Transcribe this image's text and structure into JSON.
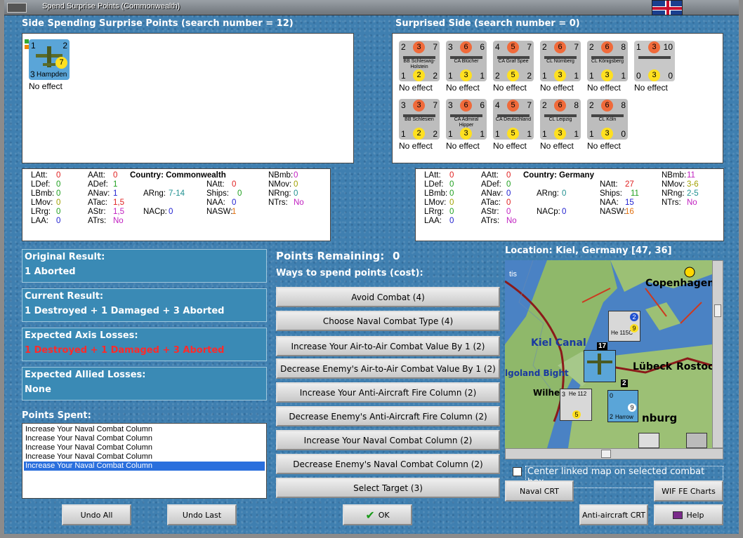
{
  "window": {
    "title": "Spend Surprise Points (Commonwealth)"
  },
  "left": {
    "header": "Side Spending Surprise Points (search number = 12)",
    "units": [
      {
        "type": "plane",
        "name": "Hampden",
        "tl": "1",
        "tr": "2",
        "bl": "3",
        "factor": "7",
        "effect": "No effect"
      }
    ]
  },
  "right": {
    "header": "Surprised Side (search number = 0)",
    "units": [
      {
        "name": "BB Schleswig-Holstein",
        "tl": "2",
        "tm": "3",
        "tr": "7",
        "bl": "1",
        "bm": "2",
        "br": "2",
        "effect": "No effect"
      },
      {
        "name": "CA Blücher",
        "tl": "3",
        "tm": "6",
        "tr": "6",
        "bl": "1",
        "bm": "3",
        "br": "1",
        "effect": "No effect"
      },
      {
        "name": "CA Graf Spee",
        "tl": "4",
        "tm": "5",
        "tr": "7",
        "bl": "2",
        "bm": "5",
        "br": "2",
        "effect": "No effect"
      },
      {
        "name": "CL Nürnberg",
        "tl": "2",
        "tm": "6",
        "tr": "7",
        "bl": "1",
        "bm": "3",
        "br": "1",
        "effect": "No effect"
      },
      {
        "name": "CL Königsberg",
        "tl": "2",
        "tm": "6",
        "tr": "8",
        "bl": "1",
        "bm": "3",
        "br": "1",
        "effect": "No effect"
      },
      {
        "name": "",
        "tl": "1",
        "tm": "3",
        "tr": "10",
        "bl": "0",
        "bm": "3",
        "br": "0",
        "effect": "No effect",
        "white": true
      },
      {
        "name": "BB Schlesien",
        "tl": "3",
        "tm": "3",
        "tr": "7",
        "bl": "1",
        "bm": "2",
        "br": "2",
        "effect": "No effect"
      },
      {
        "name": "CA Admiral Hipper",
        "tl": "3",
        "tm": "6",
        "tr": "6",
        "bl": "1",
        "bm": "3",
        "br": "1",
        "effect": "No effect"
      },
      {
        "name": "CA Deutschland",
        "tl": "4",
        "tm": "5",
        "tr": "7",
        "bl": "1",
        "bm": "5",
        "br": "1",
        "effect": "No effect"
      },
      {
        "name": "CL Leipzig",
        "tl": "2",
        "tm": "6",
        "tr": "8",
        "bl": "1",
        "bm": "3",
        "br": "1",
        "effect": "No effect"
      },
      {
        "name": "CL Köln",
        "tl": "2",
        "tm": "6",
        "tr": "8",
        "bl": "1",
        "bm": "3",
        "br": "0",
        "effect": "No effect"
      }
    ]
  },
  "stats_left": {
    "country": "Country: Commonwealth",
    "latt": "0",
    "ldef": "0",
    "lbmb": "0",
    "lmov": "0",
    "lrrg": "0",
    "laa": "0",
    "aatt": "0",
    "adef": "1",
    "anav": "1",
    "atac": "1,5",
    "astr": "1,5",
    "atrs": "No",
    "arng": "7-14",
    "nacp": "0",
    "natt": "0",
    "ships": "0",
    "naa": "0",
    "nasw": "1",
    "nbmb": "0",
    "nmov": "0",
    "nrng": "0",
    "ntrs": "No"
  },
  "stats_right": {
    "country": "Country: Germany",
    "latt": "0",
    "ldef": "0",
    "lbmb": "0",
    "lmov": "0",
    "lrrg": "0",
    "laa": "0",
    "aatt": "0",
    "adef": "0",
    "anav": "0",
    "atac": "0",
    "astr": "0",
    "atrs": "No",
    "arng": "0",
    "nacp": "0",
    "natt": "27",
    "ships": "11",
    "naa": "15",
    "nasw": "16",
    "nbmb": "11",
    "nmov": "3-6",
    "nrng": "2-5",
    "ntrs": "No"
  },
  "labels": {
    "latt": "LAtt:",
    "ldef": "LDef:",
    "lbmb": "LBmb:",
    "lmov": "LMov:",
    "lrrg": "LRrg:",
    "laa": "LAA:",
    "aatt": "AAtt:",
    "adef": "ADef:",
    "anav": "ANav:",
    "atac": "ATac:",
    "astr": "AStr:",
    "atrs": "ATrs:",
    "arng": "ARng:",
    "nacp": "NACp:",
    "natt": "NAtt:",
    "ships": "Ships:",
    "naa": "NAA:",
    "nasw": "NASW:",
    "nbmb": "NBmb:",
    "nmov": "NMov:",
    "nrng": "NRng:",
    "ntrs": "NTrs:"
  },
  "results": {
    "original": {
      "label": "Original Result:",
      "value": "1 Aborted"
    },
    "current": {
      "label": "Current Result:",
      "value": "1 Destroyed + 1 Damaged + 3 Aborted"
    },
    "axis": {
      "label": "Expected Axis Losses:",
      "value": "1 Destroyed + 1 Damaged + 3 Aborted"
    },
    "allied": {
      "label": "Expected Allied Losses:",
      "value": "None"
    }
  },
  "points": {
    "spent_label": "Points Spent:",
    "remaining_label": "Points Remaining:",
    "remaining": "0",
    "ways_label": "Ways to spend points (cost):",
    "spent": [
      "Increase Your Naval Combat Column",
      "Increase Your Naval Combat Column",
      "Increase Your Naval Combat Column",
      "Increase Your Naval Combat Column",
      "Increase Your Naval Combat Column"
    ]
  },
  "options": [
    "Avoid Combat (4)",
    "Choose Naval Combat Type (4)",
    "Increase Your Air-to-Air Combat Value By 1 (2)",
    "Decrease Enemy's Air-to-Air Combat Value By 1 (2)",
    "Increase Your Anti-Aircraft Fire Column (2)",
    "Decrease Enemy's Anti-Aircraft Fire Column (2)",
    "Increase Your Naval Combat Column (2)",
    "Decrease Enemy's Naval Combat Column (2)",
    "Select Target (3)"
  ],
  "map": {
    "location": "Location: Kiel, Germany [47, 36]",
    "labels": {
      "copenhagen": "Copenhagen",
      "kiel_canal": "Kiel Canal",
      "lubeck": "Lübeck",
      "rostock": "Rostoc",
      "heligoland": "lgoland Bight",
      "wilh": "Wilhe",
      "burg": "nburg",
      "tis": "tis"
    },
    "counters": {
      "he115": "He 115C",
      "he115_n": "2",
      "he115_f": "9",
      "he112": "He 112",
      "he112_t": "3",
      "he112_f": "5",
      "harrow": "Harrow",
      "harrow_t": "0",
      "harrow_b": "2",
      "harrow_f": "9",
      "stack1": "17",
      "stack2": "2"
    },
    "center_linked": "Center linked map on selected combat hex"
  },
  "buttons": {
    "naval_crt": "Naval CRT",
    "wif_charts": "WIF FE Charts",
    "aa_crt": "Anti-aircraft CRT",
    "help": "Help",
    "undo_all": "Undo All",
    "undo_last": "Undo Last",
    "ok": "OK"
  }
}
